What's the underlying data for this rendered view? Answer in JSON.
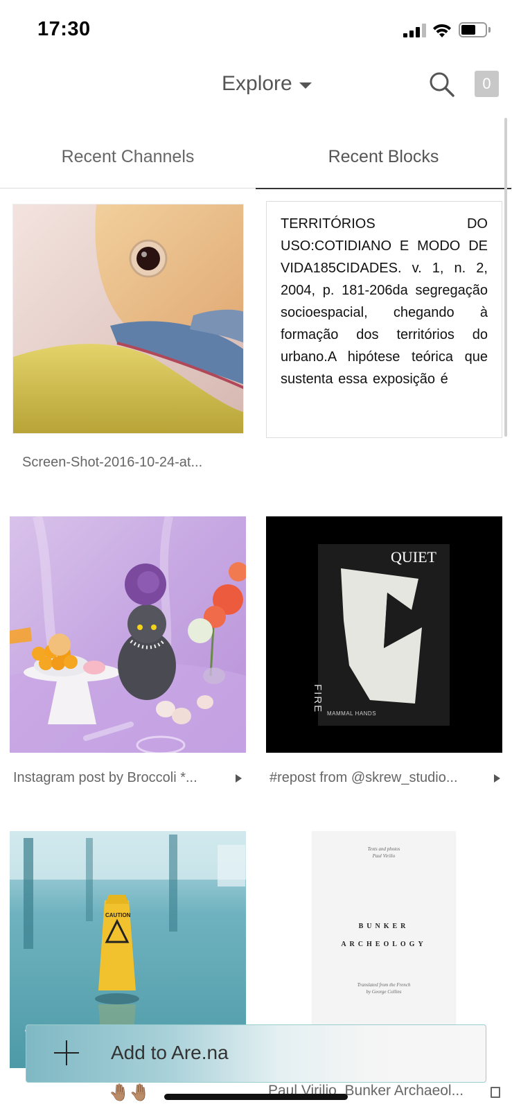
{
  "status_bar": {
    "time": "17:30"
  },
  "header": {
    "title": "Explore",
    "count": "0"
  },
  "tabs": [
    {
      "label": "Recent Channels"
    },
    {
      "label": "Recent Blocks"
    }
  ],
  "blocks": [
    {
      "caption": "Screen-Shot-2016-10-24-at..."
    },
    {
      "text": "TERRITÓRIOS DO USO:COTIDIANO E MODO DE VIDA185CIDADES. v. 1, n. 2, 2004, p. 181-206da segregação socioespacial, chegando à formação dos territórios do urbano.A hipótese teórica que sustenta essa exposição é"
    },
    {
      "caption": "Instagram post by Broccoli *..."
    },
    {
      "caption": "#repost from @skrew_studio...",
      "cover_title": "QUIET",
      "cover_side": "FIRE",
      "cover_artist": "MAMMAL HANDS"
    },
    {
      "caption": "",
      "sign_text": "CAUTION"
    },
    {
      "caption": "Paul Virilio_Bunker Archaeol...",
      "cover_top": "Texts and photos",
      "cover_author": "Paul Virilio",
      "cover_title1": "BUNKER",
      "cover_title2": "ARCHEOLOGY",
      "cover_bottom1": "Translated from the French",
      "cover_bottom2": "by George Collins"
    }
  ],
  "add_bar": {
    "label": "Add to Are.na"
  },
  "bottom": {
    "hands": "🤚🏽🤚🏽"
  }
}
